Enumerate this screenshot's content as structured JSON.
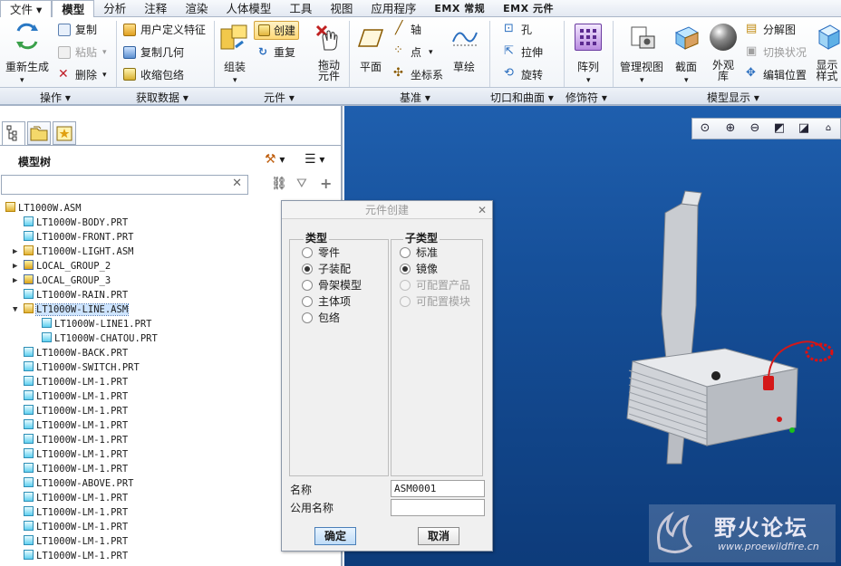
{
  "menu": {
    "items": [
      "文件",
      "模型",
      "分析",
      "注释",
      "渲染",
      "人体模型",
      "工具",
      "视图",
      "应用程序",
      "EMX 常规",
      "EMX 元件"
    ],
    "active_index": 1
  },
  "ribbon": {
    "operations": {
      "regenerate": "重新生成",
      "copy": "复制",
      "paste": "粘贴",
      "delete": "删除",
      "group": "操作"
    },
    "get_data": {
      "udf": "用户定义特征",
      "copy_geom": "复制几何",
      "shrinkwrap": "收缩包络",
      "group": "获取数据"
    },
    "component": {
      "assemble": "组装",
      "create": "创建",
      "repeat": "重复",
      "drag": "拖动元件",
      "group": "元件"
    },
    "datum": {
      "plane": "平面",
      "axis": "轴",
      "point": "点",
      "csys": "坐标系",
      "sketch": "草绘",
      "group": "基准"
    },
    "cut_surface": {
      "hole": "孔",
      "extrude": "拉伸",
      "revolve": "旋转",
      "group": "切口和曲面"
    },
    "modifiers": {
      "pattern": "阵列",
      "group": "修饰符"
    },
    "model_display": {
      "manage_views": "管理视图",
      "section": "截面",
      "appearance": "外观库",
      "exploded": "分解图",
      "toggle_status": "切换状况",
      "edit_position": "编辑位置",
      "display_style": "显示样式",
      "group": "模型显示"
    }
  },
  "model_tree": {
    "title": "模型树",
    "search_placeholder": "",
    "items": [
      {
        "label": "LT1000W.ASM",
        "type": "asm",
        "level": 0,
        "expander": ""
      },
      {
        "label": "LT1000W-BODY.PRT",
        "type": "prt",
        "level": 1,
        "expander": ""
      },
      {
        "label": "LT1000W-FRONT.PRT",
        "type": "prt",
        "level": 1,
        "expander": ""
      },
      {
        "label": "LT1000W-LIGHT.ASM",
        "type": "asm",
        "level": 1,
        "expander": "▶"
      },
      {
        "label": "LOCAL_GROUP_2",
        "type": "grp",
        "level": 1,
        "expander": "▶"
      },
      {
        "label": "LOCAL_GROUP_3",
        "type": "grp",
        "level": 1,
        "expander": "▶"
      },
      {
        "label": "LT1000W-RAIN.PRT",
        "type": "prt",
        "level": 1,
        "expander": ""
      },
      {
        "label": "LT1000W-LINE.ASM",
        "type": "asm",
        "level": 1,
        "expander": "▼",
        "selected": true
      },
      {
        "label": "LT1000W-LINE1.PRT",
        "type": "prt",
        "level": 2,
        "expander": ""
      },
      {
        "label": "LT1000W-CHATOU.PRT",
        "type": "prt",
        "level": 2,
        "expander": ""
      },
      {
        "label": "LT1000W-BACK.PRT",
        "type": "prt",
        "level": 1,
        "expander": ""
      },
      {
        "label": "LT1000W-SWITCH.PRT",
        "type": "prt",
        "level": 1,
        "expander": ""
      },
      {
        "label": "LT1000W-LM-1.PRT",
        "type": "prt",
        "level": 1,
        "expander": ""
      },
      {
        "label": "LT1000W-LM-1.PRT",
        "type": "prt",
        "level": 1,
        "expander": ""
      },
      {
        "label": "LT1000W-LM-1.PRT",
        "type": "prt",
        "level": 1,
        "expander": ""
      },
      {
        "label": "LT1000W-LM-1.PRT",
        "type": "prt",
        "level": 1,
        "expander": ""
      },
      {
        "label": "LT1000W-LM-1.PRT",
        "type": "prt",
        "level": 1,
        "expander": ""
      },
      {
        "label": "LT1000W-LM-1.PRT",
        "type": "prt",
        "level": 1,
        "expander": ""
      },
      {
        "label": "LT1000W-LM-1.PRT",
        "type": "prt",
        "level": 1,
        "expander": ""
      },
      {
        "label": "LT1000W-ABOVE.PRT",
        "type": "prt",
        "level": 1,
        "expander": ""
      },
      {
        "label": "LT1000W-LM-1.PRT",
        "type": "prt",
        "level": 1,
        "expander": ""
      },
      {
        "label": "LT1000W-LM-1.PRT",
        "type": "prt",
        "level": 1,
        "expander": ""
      },
      {
        "label": "LT1000W-LM-1.PRT",
        "type": "prt",
        "level": 1,
        "expander": ""
      },
      {
        "label": "LT1000W-LM-1.PRT",
        "type": "prt",
        "level": 1,
        "expander": ""
      },
      {
        "label": "LT1000W-LM-1.PRT",
        "type": "prt",
        "level": 1,
        "expander": ""
      }
    ]
  },
  "dialog": {
    "title": "元件创建",
    "type_label": "类型",
    "types": [
      {
        "label": "零件",
        "checked": false
      },
      {
        "label": "子装配",
        "checked": true
      },
      {
        "label": "骨架模型",
        "checked": false
      },
      {
        "label": "主体项",
        "checked": false
      },
      {
        "label": "包络",
        "checked": false
      }
    ],
    "subtype_label": "子类型",
    "subtypes": [
      {
        "label": "标准",
        "checked": false,
        "disabled": false
      },
      {
        "label": "镜像",
        "checked": true,
        "disabled": false
      },
      {
        "label": "可配置产品",
        "checked": false,
        "disabled": true
      },
      {
        "label": "可配置模块",
        "checked": false,
        "disabled": true
      }
    ],
    "name_label": "名称",
    "name_value": "ASM0001",
    "common_name_label": "公用名称",
    "common_name_value": "",
    "ok": "确定",
    "cancel": "取消"
  },
  "watermark": {
    "title": "野火论坛",
    "url": "www.proewildfire.cn"
  },
  "colors": {
    "viewport_top": "#1f5fae",
    "viewport_bottom": "#0d3b7a",
    "accent": "#4a7fb8"
  }
}
